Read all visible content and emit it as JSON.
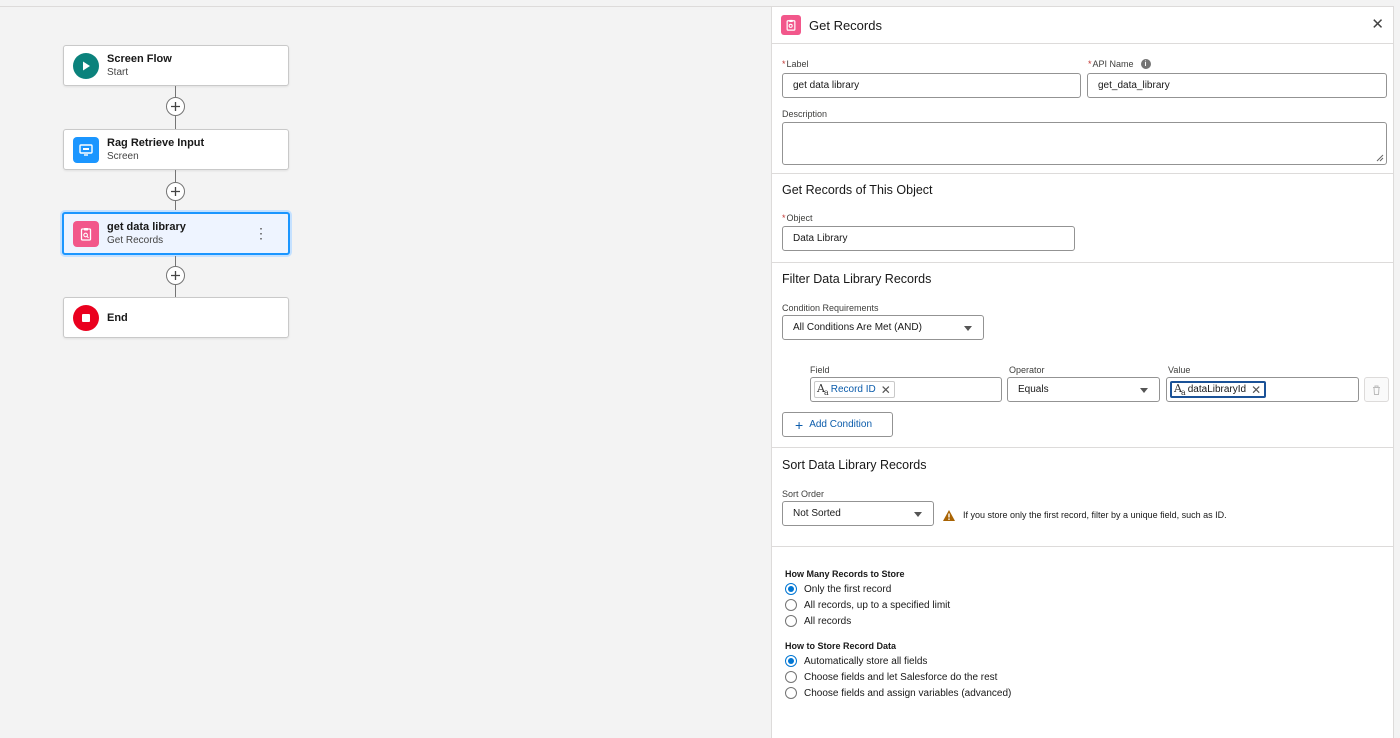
{
  "canvas": {
    "nodes": [
      {
        "title": "Screen Flow",
        "subtitle": "Start",
        "icon": "play-icon",
        "color": "#0b827c"
      },
      {
        "title": "Rag Retrieve Input",
        "subtitle": "Screen",
        "icon": "screen-icon",
        "color": "#1b96ff"
      },
      {
        "title": "get data library",
        "subtitle": "Get Records",
        "icon": "get-records-icon",
        "color": "#f2578b"
      },
      {
        "title": "End",
        "subtitle": "",
        "icon": "stop-icon",
        "color": "#ea001e"
      }
    ]
  },
  "panel": {
    "title": "Get Records",
    "label_label": "Label",
    "label_value": "get data library",
    "api_name_label": "API Name",
    "api_name_value": "get_data_library",
    "description_label": "Description",
    "description_value": "",
    "object_section": "Get Records of This Object",
    "object_label": "Object",
    "object_value": "Data Library",
    "filter_section": "Filter Data Library Records",
    "condition_req_label": "Condition Requirements",
    "condition_req_value": "All Conditions Are Met (AND)",
    "field_header": "Field",
    "operator_header": "Operator",
    "value_header": "Value",
    "condition": {
      "field": "Record ID",
      "operator": "Equals",
      "value": "dataLibraryId"
    },
    "add_condition": "Add Condition",
    "sort_section": "Sort Data Library Records",
    "sort_order_label": "Sort Order",
    "sort_order_value": "Not Sorted",
    "sort_warning": "If you store only the first record, filter by a unique field, such as ID.",
    "how_many_title": "How Many Records to Store",
    "how_many_options": [
      "Only the first record",
      "All records, up to a specified limit",
      "All records"
    ],
    "how_many_selected": 0,
    "how_store_title": "How to Store Record Data",
    "how_store_options": [
      "Automatically store all fields",
      "Choose fields and let Salesforce do the rest",
      "Choose fields and assign variables (advanced)"
    ],
    "how_store_selected": 0
  }
}
